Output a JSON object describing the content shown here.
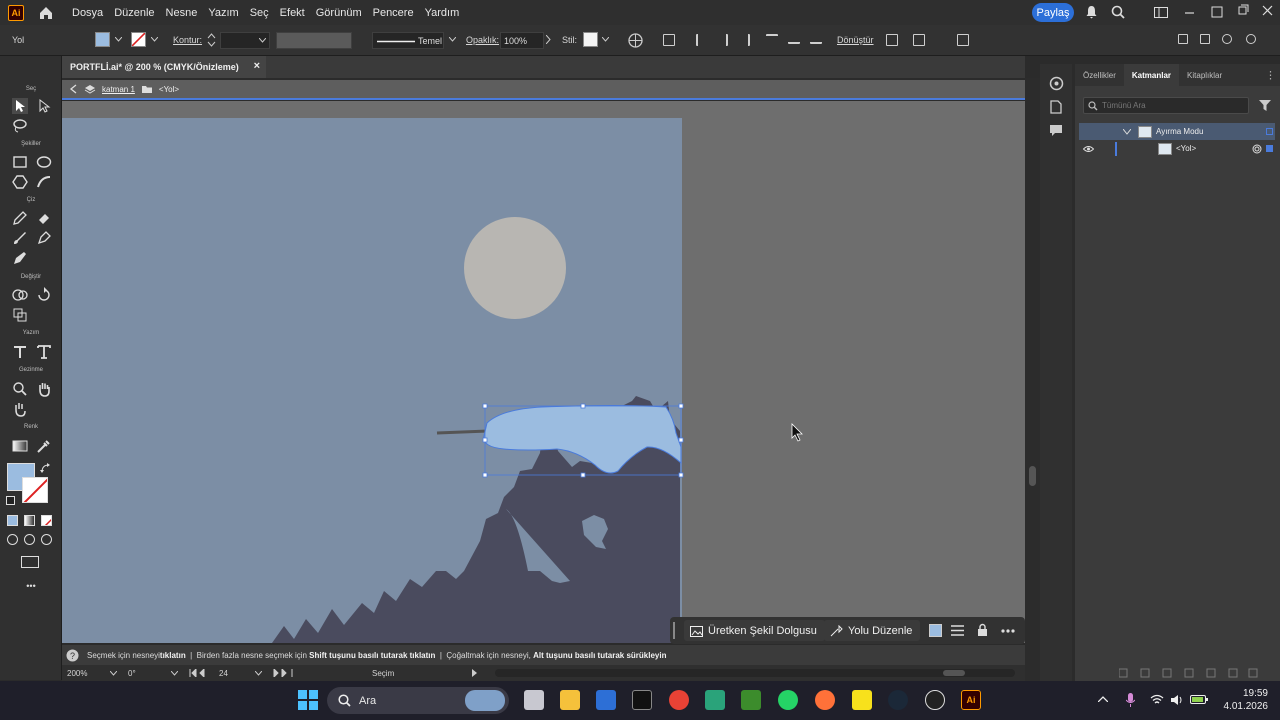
{
  "app": {
    "logo_text": "Ai",
    "menus": [
      "Dosya",
      "Düzenle",
      "Nesne",
      "Yazım",
      "Seç",
      "Efekt",
      "Görünüm",
      "Pencere",
      "Yardım"
    ],
    "share_label": "Paylaş"
  },
  "control": {
    "object_type": "Yol",
    "fill_color": "#9bbce0",
    "stroke_label": "Kontur:",
    "stroke_style": "Temel",
    "opacity_label": "Opaklık:",
    "opacity_value": "100%",
    "style_label": "Stil:",
    "transform_label": "Dönüştür"
  },
  "document": {
    "tab_title": "PORTFLİ.ai* @ 200 % (CMYK/Önizleme)",
    "close_glyph": "×",
    "breadcrumb_layer": "katman 1",
    "breadcrumb_object": "<Yol>"
  },
  "tools": {
    "sections": [
      "Seç",
      "Şekiller",
      "Çiz",
      "Değiştir",
      "Yazım",
      "Gezinme",
      "Renk"
    ],
    "more_glyph": "•••"
  },
  "artwork": {
    "sky_color": "#7c8ea5",
    "moon_color": "#b8b6b2",
    "trees_color": "#4a4b5e",
    "cloud_color": "#9bbce0",
    "selection_color": "#4a7bdc"
  },
  "context_bar": {
    "generative_fill": "Üretken Şekil Dolgusu",
    "edit_path": "Yolu Düzenle"
  },
  "hint": {
    "p1": "Seçmek için nesneyi ",
    "b1": "tıklatın",
    "p2": "  |  Birden fazla nesne seçmek için ",
    "b2": "Shift tuşunu basılı tutarak tıklatın",
    "p3": "  |  Çoğaltmak için nesneyi, ",
    "b3": "Alt tuşunu basılı tutarak sürükleyin"
  },
  "status": {
    "zoom": "200%",
    "rotation": "0°",
    "artboard": "24",
    "tool": "Seçim"
  },
  "layers_panel": {
    "tabs": [
      "Özellikler",
      "Katmanlar",
      "Kitaplıklar"
    ],
    "search_placeholder": "Tümünü Ara",
    "rows": [
      {
        "name": "Ayırma Modu"
      },
      {
        "name": "<Yol>"
      }
    ]
  },
  "taskbar": {
    "search_label": "Ara",
    "time": "19:59",
    "date": "4.01.2026"
  }
}
